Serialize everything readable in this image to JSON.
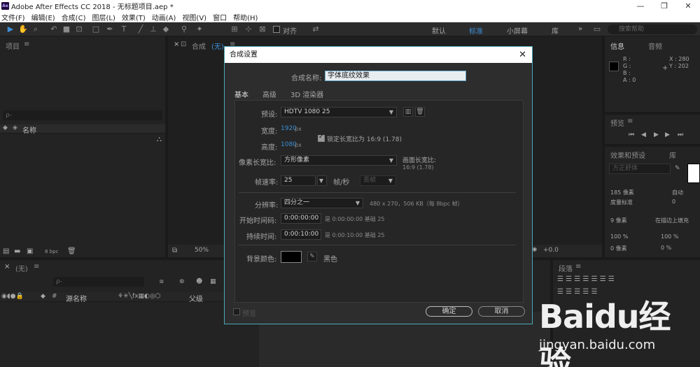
{
  "window": {
    "title": "Adobe After Effects CC 2018 - 无标题项目.aep *",
    "app_badge": "Ae",
    "controls": [
      "—",
      "❐",
      "✕"
    ]
  },
  "menu": [
    "文件(F)",
    "编辑(E)",
    "合成(C)",
    "图层(L)",
    "效果(T)",
    "动画(A)",
    "视图(V)",
    "窗口",
    "帮助(H)"
  ],
  "toolbar": {
    "snap_label": "对齐",
    "workspaces": [
      "默认",
      "标准",
      "小屏幕",
      "库"
    ],
    "active_workspace": "标准",
    "overflow": "»",
    "search_placeholder": "搜索帮助"
  },
  "project_panel": {
    "title": "项目",
    "menu": "≡",
    "search_placeholder": "ρ-",
    "column_name": "名称",
    "bpc": "8 bpc"
  },
  "comp_panel": {
    "title": "合成",
    "name": "(无)",
    "menu": "≡",
    "zoom": "50%",
    "offset": "+0.0"
  },
  "info_panel": {
    "tab1": "信息",
    "tab2": "音频",
    "r": "R :",
    "g": "G :",
    "b": "B :",
    "a": "A : 0",
    "x": "X : 280",
    "y": "Y : 202"
  },
  "preview_panel": {
    "title": "预览",
    "menu": "≡"
  },
  "effects_panel": {
    "title": "效果和预设",
    "tab2": "库",
    "preset": "方正舒体",
    "menu": "≡"
  },
  "char_panel": {
    "size": "185 像素",
    "auto": "自动",
    "tracking": "度量标准",
    "stroke": "9 像素",
    "stroke_mode": "在描边上填充",
    "scale_v": "100 %",
    "scale_h": "100 %",
    "baseline": "0 像素",
    "tsume": "0 %"
  },
  "para_panel": {
    "title": "段落",
    "menu": "≡"
  },
  "timeline": {
    "tab": "(无)",
    "menu": "≡",
    "search_placeholder": "ρ-",
    "col_source": "源名称",
    "col_parent": "父级"
  },
  "dialog": {
    "title": "合成设置",
    "close": "✕",
    "name_label": "合成名称:",
    "name_value": "字体底纹效果",
    "tabs": [
      "基本",
      "高级",
      "3D 渲染器"
    ],
    "preset_label": "预设:",
    "preset_value": "HDTV 1080 25",
    "width_label": "宽度:",
    "width_value": "1920",
    "width_unit": "px",
    "height_label": "高度:",
    "height_value": "1080",
    "height_unit": "px",
    "lock_label": "锁定长宽比为 16:9 (1.78)",
    "lock_checked": true,
    "pixel_aspect_label": "像素长宽比:",
    "pixel_aspect_value": "方形像素",
    "frame_aspect_label": "画面长宽比:",
    "frame_aspect_value": "16:9 (1.78)",
    "fps_label": "帧速率:",
    "fps_value": "25",
    "fps_unit": "帧/秒",
    "fps_mode": "丢帧",
    "resolution_label": "分辨率:",
    "resolution_value": "四分之一",
    "resolution_info": "480 x 270，506 KB（每 8bpc 帧）",
    "start_label": "开始时间码:",
    "start_value": "0:00:00:00",
    "start_info": "是 0:00:00:00 基础 25",
    "duration_label": "持续时间:",
    "duration_value": "0:00:10:00",
    "duration_info": "是 0:00:10:00 基础 25",
    "bg_label": "背景颜色:",
    "bg_color_name": "黑色",
    "bg_color": "#000000",
    "preview_label": "预览",
    "ok": "确定",
    "cancel": "取消"
  },
  "watermark": {
    "logo": "Baidu经验",
    "url": "jingyan.baidu.com"
  },
  "colors": {
    "accent": "#3a8fd8",
    "dialog_border": "#4aa8b8",
    "panel_bg": "#232323"
  }
}
